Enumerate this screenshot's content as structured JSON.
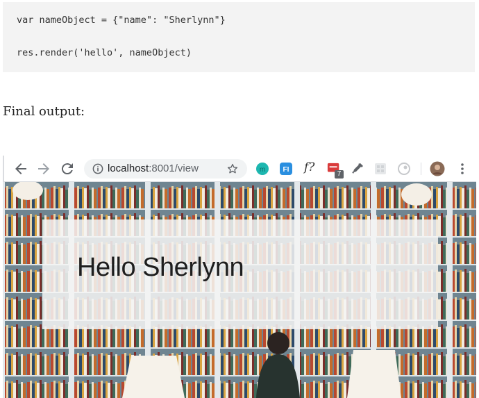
{
  "code": {
    "lines": [
      "var nameObject = {\"name\": \"Sherlynn\"}",
      "res.render('hello', nameObject)"
    ]
  },
  "caption": "Final output:",
  "browser": {
    "url_host": "localhost",
    "url_rest": ":8001/view",
    "extension_letter_f": "f?",
    "extension_badge": "7",
    "extension_fi": "FI",
    "extension_m": "m"
  },
  "page": {
    "heading": "Hello Sherlynn"
  },
  "colors": {
    "shelf": "#6f8591",
    "card": "#f5f5f5",
    "accent_teal": "#1db7b0",
    "accent_blue": "#2a8fe0",
    "accent_red": "#d93b3b"
  }
}
